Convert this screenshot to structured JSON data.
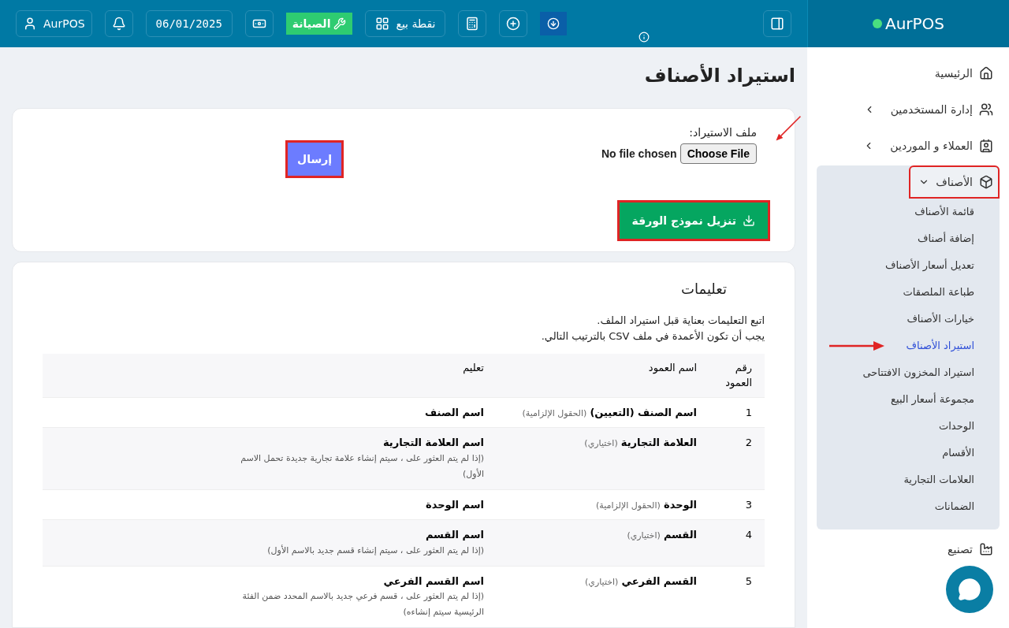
{
  "header": {
    "brand": "AurPOS",
    "user": "AurPOS",
    "date": "06/01/2025",
    "maintenance": "الصيانة",
    "pos": "نقطة بيع"
  },
  "sidebar": {
    "items": [
      {
        "label": "الرئيسية",
        "chevron": false,
        "expanded": false,
        "highlighted": false
      },
      {
        "label": "إدارة المستخدمين",
        "chevron": true,
        "expanded": false,
        "highlighted": false
      },
      {
        "label": "العملاء و الموردين",
        "chevron": true,
        "expanded": false,
        "highlighted": false
      },
      {
        "label": "الأصناف",
        "chevron": true,
        "expanded": true,
        "highlighted": true,
        "children": [
          {
            "label": "قائمة الأصناف",
            "selected": false
          },
          {
            "label": "إضافة أصناف",
            "selected": false
          },
          {
            "label": "تعديل أسعار الأصناف",
            "selected": false
          },
          {
            "label": "طباعة الملصقات",
            "selected": false
          },
          {
            "label": "خيارات الأصناف",
            "selected": false
          },
          {
            "label": "استيراد الأصناف",
            "selected": true
          },
          {
            "label": "استيراد المخزون الافتتاحى",
            "selected": false
          },
          {
            "label": "مجموعة أسعار البيع",
            "selected": false
          },
          {
            "label": "الوحدات",
            "selected": false
          },
          {
            "label": "الأقسام",
            "selected": false
          },
          {
            "label": "العلامات التجارية",
            "selected": false
          },
          {
            "label": "الضمانات",
            "selected": false
          }
        ]
      },
      {
        "label": "تصنيع",
        "chevron": false,
        "expanded": false,
        "highlighted": false
      }
    ]
  },
  "page_title": "استيراد الأصناف",
  "upload": {
    "label": "ملف الاستيراد:",
    "choose_button": "Choose File",
    "file_status": "No file chosen",
    "submit": {
      "label": "إرسال",
      "highlighted": true
    },
    "download": {
      "label": "تنزيل نموذج الورقة",
      "highlighted": true
    }
  },
  "instructions": {
    "title": "تعليمات",
    "lines": [
      "اتبع التعليمات بعناية قبل استيراد الملف.",
      "يجب أن تكون الأعمدة في ملف CSV بالترتيب التالي."
    ],
    "columns": [
      "رقم العمود",
      "اسم العمود",
      "تعليم"
    ],
    "rows": [
      {
        "number": "1",
        "name": "اسم الصنف (التعيين)",
        "name_note": "(الحقول الإلزامية)",
        "instruction": "اسم الصنف"
      },
      {
        "number": "2",
        "name": "العلامة التجارية",
        "name_note": "(اختياري)",
        "instruction": "اسم العلامة التجارية",
        "instruction_note": "(إذا لم يتم العثور على ، سيتم إنشاء علامة تجارية جديدة تحمل الاسم الأول)"
      },
      {
        "number": "3",
        "name": "الوحدة",
        "name_note": "(الحقول الإلزامية)",
        "instruction": "اسم الوحدة"
      },
      {
        "number": "4",
        "name": "القسم",
        "name_note": "(اختياري)",
        "instruction": "اسم القسم",
        "instruction_note": "(إذا لم يتم العثور على ، سيتم إنشاء قسم جديد بالاسم الأول)"
      },
      {
        "number": "5",
        "name": "القسم الفرعي",
        "name_note": "(اختياري)",
        "instruction": "اسم القسم الفرعي",
        "instruction_note": "(إذا لم يتم العثور على ، قسم فرعي جديد بالاسم المحدد ضمن الفئة الرئيسية سيتم إنشاءه)"
      }
    ]
  }
}
